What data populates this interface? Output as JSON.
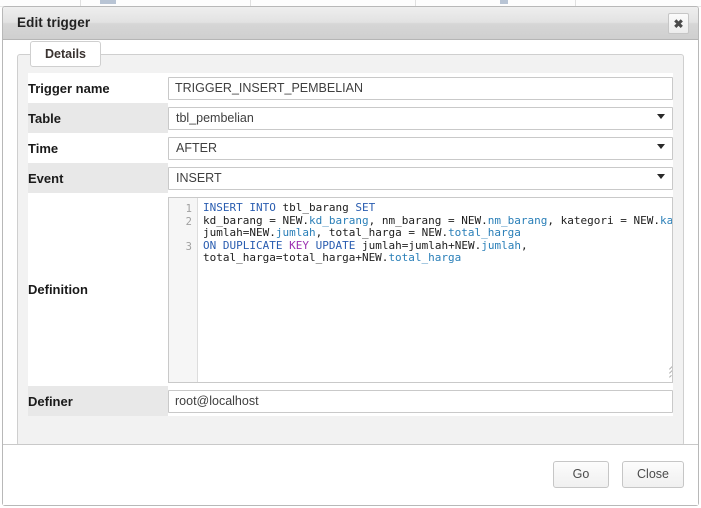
{
  "window": {
    "title": "Edit trigger",
    "close_icon": "close-x-icon",
    "close_label": "✖"
  },
  "panel": {
    "tab_label": "Details"
  },
  "form": {
    "rows": [
      {
        "label": "Trigger name",
        "type": "text",
        "value": "TRIGGER_INSERT_PEMBELIAN"
      },
      {
        "label": "Table",
        "type": "select",
        "value": "tbl_pembelian"
      },
      {
        "label": "Time",
        "type": "select",
        "value": "AFTER"
      },
      {
        "label": "Event",
        "type": "select",
        "value": "INSERT"
      }
    ],
    "definition": {
      "label": "Definition",
      "line_numbers": [
        "1",
        "2",
        "3"
      ],
      "lines": [
        "INSERT INTO tbl_barang SET",
        "kd_barang = NEW.kd_barang, nm_barang = NEW.nm_barang, kategori = NEW.kategori,",
        "jumlah=NEW.jumlah, total_harga = NEW.total_harga",
        "ON DUPLICATE KEY UPDATE jumlah=jumlah+NEW.jumlah,",
        "total_harga=total_harga+NEW.total_harga"
      ],
      "resize_grip": "resize-grip-icon"
    },
    "definer": {
      "label": "Definer",
      "type": "text",
      "value": "root@localhost"
    }
  },
  "footer": {
    "go_label": "Go",
    "close_label": "Close"
  },
  "colors": {
    "keyword_blue": "#2a5db0",
    "keyword_magenta": "#9b30b0",
    "property_blue": "#2a7fb8",
    "row_alt": "#e8e8e8",
    "panel_bg": "#f2f2f2"
  }
}
